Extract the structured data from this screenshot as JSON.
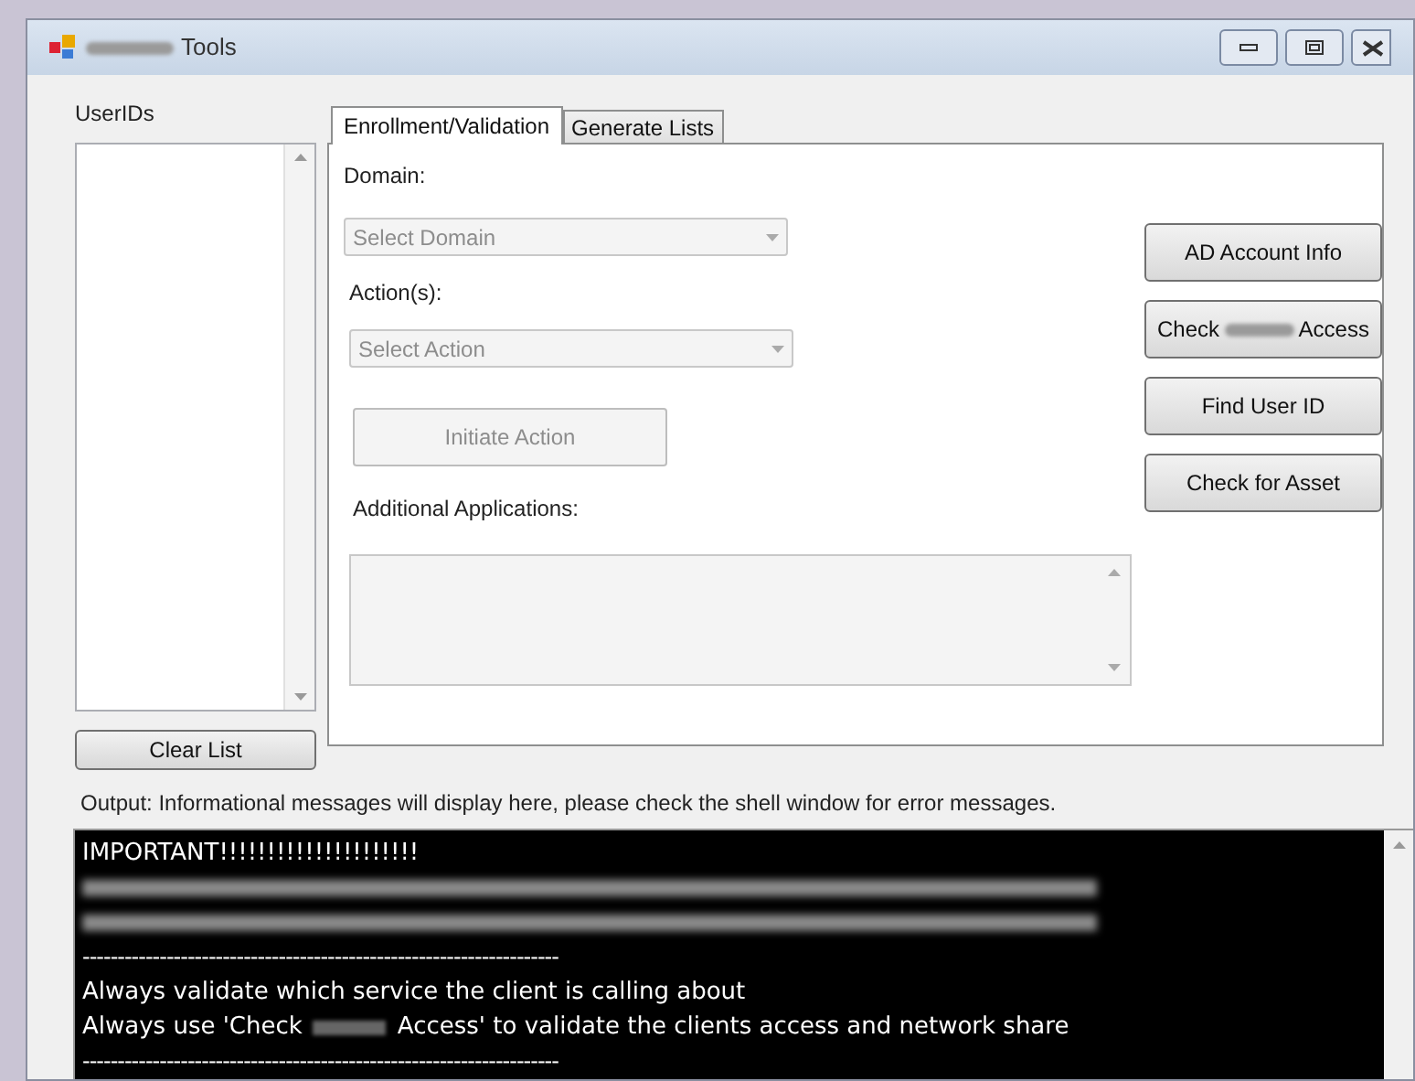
{
  "window": {
    "title": "Tools",
    "title_redacted": true
  },
  "userids": {
    "label": "UserIDs",
    "clear_button": "Clear List"
  },
  "tabs": [
    {
      "label": "Enrollment/Validation",
      "selected": true
    },
    {
      "label": "Generate Lists",
      "selected": false
    }
  ],
  "form": {
    "domain_label": "Domain:",
    "domain_placeholder": "Select Domain",
    "action_label": "Action(s):",
    "action_placeholder": "Select Action",
    "initiate_button": "Initiate Action",
    "initiate_disabled": true,
    "additional_label": "Additional Applications:"
  },
  "side_buttons": [
    {
      "kind": "plain",
      "label": "AD Account Info"
    },
    {
      "kind": "redacted",
      "parts": [
        "Check",
        "Access"
      ]
    },
    {
      "kind": "plain",
      "label": "Find User ID"
    },
    {
      "kind": "plain",
      "label": "Check for Asset"
    }
  ],
  "output_label": "Output: Informational messages will display here, please check the shell window for error messages.",
  "output_lines": [
    {
      "kind": "text",
      "text": "IMPORTANT!!!!!!!!!!!!!!!!!!!!!"
    },
    {
      "kind": "redacted"
    },
    {
      "kind": "redacted"
    },
    {
      "kind": "text",
      "text": "--------------------------------------------------------------------"
    },
    {
      "kind": "text",
      "text": "Always validate which service the client is calling about"
    },
    {
      "kind": "split",
      "parts": [
        "Always use 'Check",
        "Access' to validate the clients access and network share"
      ]
    },
    {
      "kind": "text",
      "text": "--------------------------------------------------------------------"
    }
  ]
}
